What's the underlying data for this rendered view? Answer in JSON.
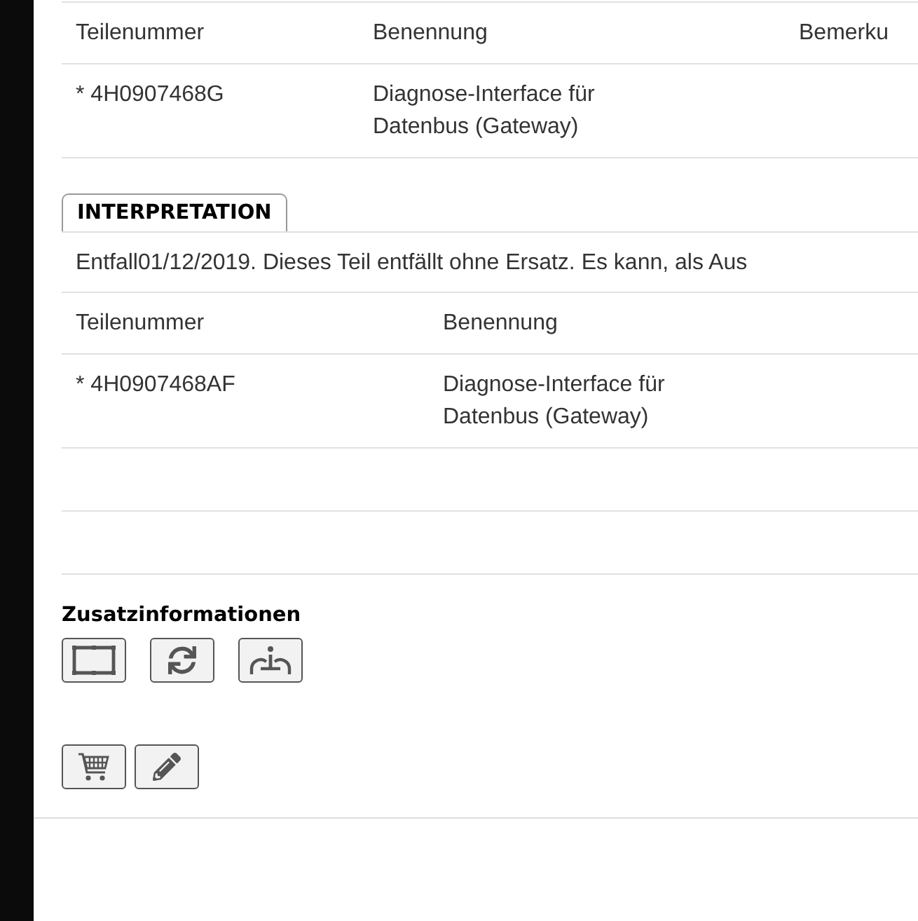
{
  "parts_table": {
    "columns": [
      "Teilenummer",
      "Benennung",
      "Bemerku"
    ],
    "rows": [
      {
        "part_number": "* 4H0907468G",
        "name": "Diagnose-Interface für Datenbus (Gateway)"
      }
    ]
  },
  "interpretation": {
    "tabs": [
      {
        "label": "INTERPRETATION",
        "selected": true
      }
    ],
    "note": "Entfall01/12/2019. Dieses Teil entfällt ohne Ersatz. Es kann, als Aus",
    "table": {
      "columns": [
        "Teilenummer",
        "Benennung"
      ],
      "rows": [
        {
          "part_number": "* 4H0907468AF",
          "name": "Diagnose-Interface für Datenbus (Gateway)"
        }
      ]
    }
  },
  "additional_info": {
    "title": "Zusatzinformationen"
  }
}
